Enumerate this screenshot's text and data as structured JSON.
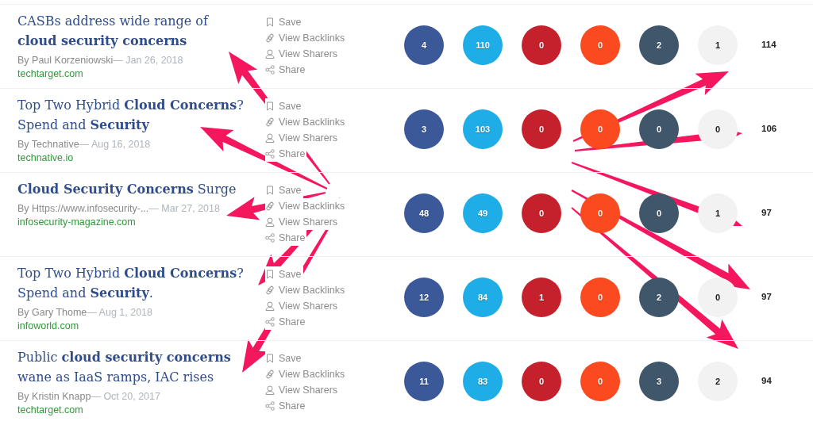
{
  "results": [
    {
      "title": "CASBs address wide range of **cloud security concerns**",
      "author": "By Paul Korzeniowski",
      "date": "— Jan 26, 2018",
      "domain": "techtarget.com",
      "actions": [
        "Save",
        "View Backlinks",
        "View Sharers",
        "Share"
      ],
      "shares": [
        {
          "value": "4",
          "color": "#3b5998"
        },
        {
          "value": "110",
          "color": "#1fade8"
        },
        {
          "value": "0",
          "color": "#c4212c"
        },
        {
          "value": "0",
          "color": "#fb4a1f"
        },
        {
          "value": "2",
          "color": "#40566a"
        },
        {
          "value": "1",
          "color": "#f2f2f2"
        }
      ],
      "total": "114"
    },
    {
      "title": "Top Two Hybrid **Cloud Concerns**? Spend and **Security**",
      "author": "By Technative",
      "date": "— Aug 16, 2018",
      "domain": "technative.io",
      "actions": [
        "Save",
        "View Backlinks",
        "View Sharers",
        "Share"
      ],
      "shares": [
        {
          "value": "3",
          "color": "#3b5998"
        },
        {
          "value": "103",
          "color": "#1fade8"
        },
        {
          "value": "0",
          "color": "#c4212c"
        },
        {
          "value": "0",
          "color": "#fb4a1f"
        },
        {
          "value": "0",
          "color": "#40566a"
        },
        {
          "value": "0",
          "color": "#f2f2f2"
        }
      ],
      "total": "106"
    },
    {
      "title": "**Cloud Security Concerns** Surge",
      "author": "By Https://www.infosecurity-...",
      "date": "— Mar 27, 2018",
      "domain": "infosecurity-magazine.com",
      "actions": [
        "Save",
        "View Backlinks",
        "View Sharers",
        "Share"
      ],
      "shares": [
        {
          "value": "48",
          "color": "#3b5998"
        },
        {
          "value": "49",
          "color": "#1fade8"
        },
        {
          "value": "0",
          "color": "#c4212c"
        },
        {
          "value": "0",
          "color": "#fb4a1f"
        },
        {
          "value": "0",
          "color": "#40566a"
        },
        {
          "value": "1",
          "color": "#f2f2f2"
        }
      ],
      "total": "97"
    },
    {
      "title": "Top Two Hybrid **Cloud Concerns**? Spend and **Security**.",
      "author": "By Gary Thome",
      "date": "— Aug 1, 2018",
      "domain": "infoworld.com",
      "actions": [
        "Save",
        "View Backlinks",
        "View Sharers",
        "Share"
      ],
      "shares": [
        {
          "value": "12",
          "color": "#3b5998"
        },
        {
          "value": "84",
          "color": "#1fade8"
        },
        {
          "value": "1",
          "color": "#c4212c"
        },
        {
          "value": "0",
          "color": "#fb4a1f"
        },
        {
          "value": "2",
          "color": "#40566a"
        },
        {
          "value": "0",
          "color": "#f2f2f2"
        }
      ],
      "total": "97"
    },
    {
      "title": "Public **cloud security concerns** wane as IaaS ramps, IAC rises",
      "author": "By Kristin Knapp",
      "date": "— Oct 20, 2017",
      "domain": "techtarget.com",
      "actions": [
        "Save",
        "View Backlinks",
        "View Sharers",
        "Share"
      ],
      "shares": [
        {
          "value": "11",
          "color": "#3b5998"
        },
        {
          "value": "83",
          "color": "#1fade8"
        },
        {
          "value": "0",
          "color": "#c4212c"
        },
        {
          "value": "0",
          "color": "#fb4a1f"
        },
        {
          "value": "3",
          "color": "#40566a"
        },
        {
          "value": "2",
          "color": "#f2f2f2"
        }
      ],
      "total": "94"
    }
  ]
}
